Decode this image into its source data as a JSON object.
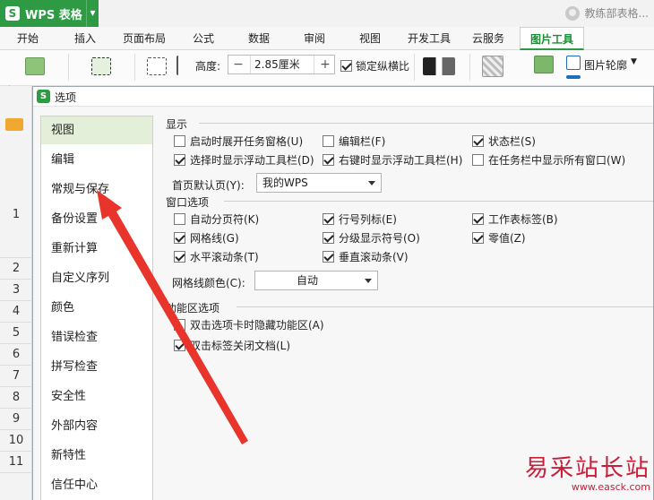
{
  "app": {
    "title": "WPS 表格",
    "user": "教练部表格..."
  },
  "tabs": [
    {
      "label": "开始"
    },
    {
      "label": "插入"
    },
    {
      "label": "页面布局"
    },
    {
      "label": "公式"
    },
    {
      "label": "数据"
    },
    {
      "label": "审阅"
    },
    {
      "label": "视图"
    },
    {
      "label": "开发工具"
    },
    {
      "label": "云服务"
    },
    {
      "label": "图片工具"
    }
  ],
  "active_tab": "图片工具",
  "ribbon": {
    "insert_label": "插入",
    "height_label": "高度:",
    "height_value": "2.85厘米",
    "minus": "−",
    "plus": "+",
    "lock_ratio_label": "锁定纵横比",
    "outline_label": "图片轮廓"
  },
  "rows": [
    "1",
    "2",
    "3",
    "4",
    "5",
    "6",
    "7",
    "8",
    "9",
    "10",
    "11"
  ],
  "dialog": {
    "title": "选项",
    "nav": [
      "视图",
      "编辑",
      "常规与保存",
      "备份设置",
      "重新计算",
      "自定义序列",
      "颜色",
      "错误检查",
      "拼写检查",
      "安全性",
      "外部内容",
      "新特性",
      "信任中心"
    ],
    "selected_nav": "视图",
    "display": {
      "title": "显示",
      "opt_taskpane": "启动时展开任务窗格(U)",
      "opt_formulabar": "编辑栏(F)",
      "opt_statusbar": "状态栏(S)",
      "opt_floattool": "选择时显示浮动工具栏(D)",
      "opt_rightfloat": "右键时显示浮动工具栏(H)",
      "opt_taskbarwin": "在任务栏中显示所有窗口(W)",
      "home_label": "首页默认页(Y):",
      "home_value": "我的WPS"
    },
    "window": {
      "title": "窗口选项",
      "opt_pagebreak": "自动分页符(K)",
      "opt_rowcol": "行号列标(E)",
      "opt_sheettab": "工作表标签(B)",
      "opt_grid": "网格线(G)",
      "opt_outline": "分级显示符号(O)",
      "opt_zero": "零值(Z)",
      "opt_hscroll": "水平滚动条(T)",
      "opt_vscroll": "垂直滚动条(V)",
      "grid_color_label": "网格线颜色(C):",
      "grid_color_value": "自动"
    },
    "ribbon_opts": {
      "title": "功能区选项",
      "opt_dblhide": "双击选项卡时隐藏功能区(A)",
      "opt_dblclose": "双击标签关闭文档(L)"
    }
  },
  "watermark": {
    "text": "易采站长站",
    "url": "www.easck.com"
  },
  "colors": {
    "brand": "#2e9a44",
    "selected_nav": "#e3efd9",
    "arrow": "#e8342b",
    "watermark": "#c81e3a"
  }
}
